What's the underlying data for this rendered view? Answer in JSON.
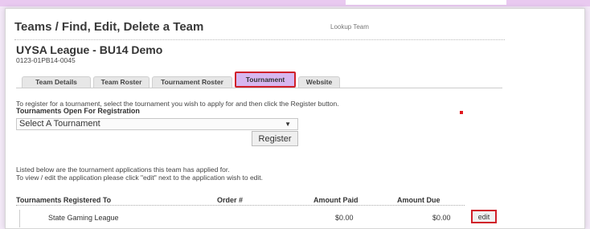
{
  "header": {
    "title": "Teams / Find, Edit, Delete a Team",
    "lookup": "Lookup Team"
  },
  "team": {
    "name": "UYSA League - BU14 Demo",
    "code": "0123-01PB14-0045"
  },
  "tabs": [
    {
      "label": "Team Details",
      "active": false
    },
    {
      "label": "Team Roster",
      "active": false
    },
    {
      "label": "Tournament Roster",
      "active": false
    },
    {
      "label": "Tournament",
      "active": true
    },
    {
      "label": "Website",
      "active": false
    }
  ],
  "register": {
    "instruction": "To register for a tournament, select the tournament you wish to apply for and then click the Register button.",
    "section_label": "Tournaments Open For Registration",
    "select_value": "Select A Tournament",
    "button": "Register"
  },
  "applications": {
    "line1": "Listed below are the tournament applications this team has applied for.",
    "line2": "To view / edit the application please click \"edit\" next to the application wish to edit.",
    "columns": [
      "Tournaments Registered To",
      "Order #",
      "Amount Paid",
      "Amount Due"
    ],
    "rows": [
      {
        "tournament": "State Gaming League",
        "order": "",
        "paid": "$0.00",
        "due": "$0.00",
        "action": "edit"
      }
    ]
  },
  "colors": {
    "highlight": "#d0202a",
    "active_tab": "#d7b7f0",
    "background": "#f3e9f7"
  }
}
